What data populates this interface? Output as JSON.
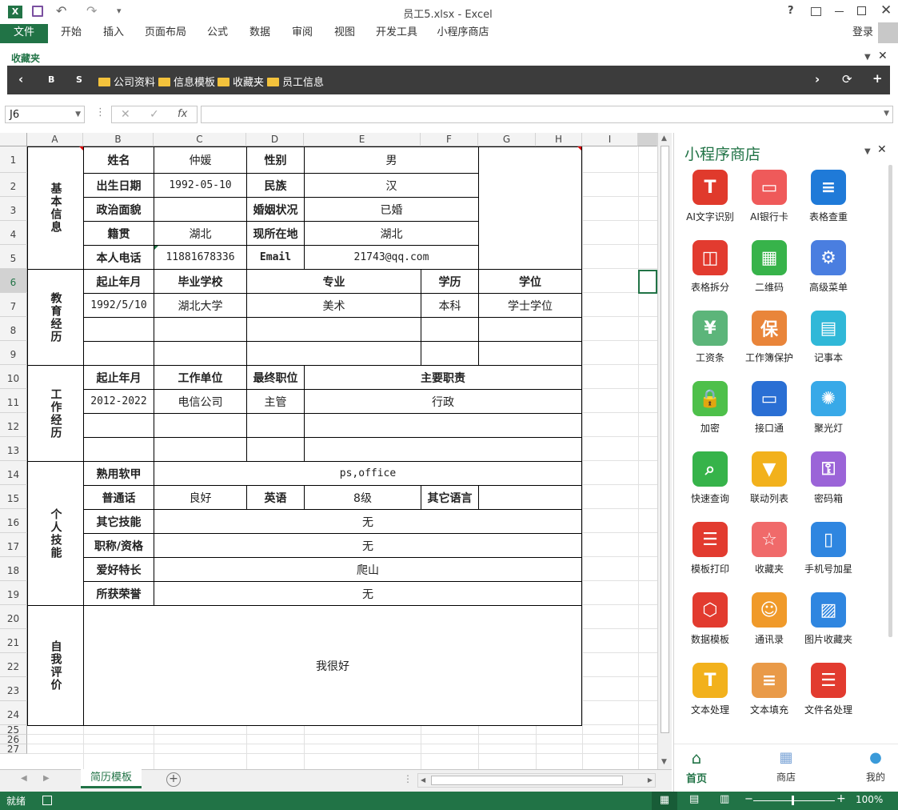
{
  "window": {
    "title": "员工5.xlsx - Excel"
  },
  "qat": {
    "undo": "↶",
    "redo": "↷",
    "more": "▾"
  },
  "ribbon": {
    "file": "文件",
    "tabs": [
      "开始",
      "插入",
      "页面布局",
      "公式",
      "数据",
      "审阅",
      "视图",
      "开发工具",
      "小程序商店"
    ],
    "login": "登录"
  },
  "favbar": {
    "label": "收藏夹",
    "b": "B",
    "s": "S",
    "folders": [
      "公司资料",
      "信息模板",
      "收藏夹",
      "员工信息"
    ]
  },
  "formula": {
    "namebox": "J6",
    "fx": "fx",
    "value": ""
  },
  "sheet": {
    "columns": [
      "A",
      "B",
      "C",
      "D",
      "E",
      "F",
      "G",
      "H",
      "I"
    ],
    "rows": [
      "1",
      "2",
      "3",
      "4",
      "5",
      "6",
      "7",
      "8",
      "9",
      "10",
      "11",
      "12",
      "13",
      "14",
      "15",
      "16",
      "17",
      "18",
      "19",
      "20",
      "21",
      "22",
      "23",
      "24",
      "25",
      "26",
      "27"
    ],
    "sections": {
      "basic": "基本信息",
      "edu": "教育经历",
      "work": "工作经历",
      "skills": "个人技能",
      "self": "自我评价"
    },
    "basic": {
      "name_l": "姓名",
      "name_v": "仲媛",
      "gender_l": "性别",
      "gender_v": "男",
      "dob_l": "出生日期",
      "dob_v": "1992-05-10",
      "nation_l": "民族",
      "nation_v": "汉",
      "politics_l": "政治面貌",
      "politics_v": "",
      "marital_l": "婚姻状况",
      "marital_v": "已婚",
      "native_l": "籍贯",
      "native_v": "湖北",
      "residence_l": "现所在地",
      "residence_v": "湖北",
      "phone_l": "本人电话",
      "phone_v": "11881678336",
      "email_l": "Email",
      "email_v": "21743@qq.com"
    },
    "edu": {
      "period_l": "起止年月",
      "school_l": "毕业学校",
      "major_l": "专业",
      "degree_l": "学历",
      "title_l": "学位",
      "period_v": "1992/5/10",
      "school_v": "湖北大学",
      "major_v": "美术",
      "degree_v": "本科",
      "title_v": "学士学位"
    },
    "work": {
      "period_l": "起止年月",
      "company_l": "工作单位",
      "position_l": "最终职位",
      "duty_l": "主要职责",
      "period_v": "2012-2022",
      "company_v": "电信公司",
      "position_v": "主管",
      "duty_v": "行政"
    },
    "skills": {
      "software_l": "熟用软甲",
      "software_v": "ps,office",
      "mandarin_l": "普通话",
      "mandarin_v": "良好",
      "english_l": "英语",
      "english_v": "8级",
      "otherlang_l": "其它语言",
      "otherlang_v": "",
      "other_l": "其它技能",
      "other_v": "无",
      "cert_l": "职称/资格",
      "cert_v": "无",
      "hobby_l": "爱好特长",
      "hobby_v": "爬山",
      "honor_l": "所获荣誉",
      "honor_v": "无"
    },
    "self_v": "我很好",
    "tab_name": "简历模板"
  },
  "panel": {
    "title": "小程序商店",
    "apps": [
      {
        "name": "AI文字识别",
        "icon": "text-recognition-icon",
        "color": "#e03a2c",
        "glyph": "T"
      },
      {
        "name": "AI银行卡",
        "icon": "bank-card-icon",
        "color": "#ef5a5a",
        "glyph": "▭"
      },
      {
        "name": "表格查重",
        "icon": "table-dedupe-icon",
        "color": "#1f7ad8",
        "glyph": "≡"
      },
      {
        "name": "表格拆分",
        "icon": "table-split-icon",
        "color": "#e23b2f",
        "glyph": "◫"
      },
      {
        "name": "二维码",
        "icon": "qrcode-icon",
        "color": "#37b34a",
        "glyph": "▦"
      },
      {
        "name": "高级菜单",
        "icon": "advanced-menu-icon",
        "color": "#4a7ee0",
        "glyph": "⚙"
      },
      {
        "name": "工资条",
        "icon": "payslip-icon",
        "color": "#5cb57a",
        "glyph": "¥"
      },
      {
        "name": "工作簿保护",
        "icon": "workbook-protect-icon",
        "color": "#e9853a",
        "glyph": "保"
      },
      {
        "name": "记事本",
        "icon": "notepad-icon",
        "color": "#30b8d8",
        "glyph": "▤"
      },
      {
        "name": "加密",
        "icon": "lock-icon",
        "color": "#4ec04a",
        "glyph": "🔒"
      },
      {
        "name": "接口通",
        "icon": "monitor-icon",
        "color": "#2a6fd4",
        "glyph": "▭"
      },
      {
        "name": "聚光灯",
        "icon": "spotlight-icon",
        "color": "#38a9e8",
        "glyph": "✺"
      },
      {
        "name": "快速查询",
        "icon": "quick-search-icon",
        "color": "#36b34a",
        "glyph": "⌕"
      },
      {
        "name": "联动列表",
        "icon": "linked-list-icon",
        "color": "#f2b11c",
        "glyph": "▼"
      },
      {
        "name": "密码箱",
        "icon": "password-box-icon",
        "color": "#9b64d8",
        "glyph": "⚿"
      },
      {
        "name": "模板打印",
        "icon": "template-print-icon",
        "color": "#e23b2f",
        "glyph": "☰"
      },
      {
        "name": "收藏夹",
        "icon": "favorites-icon",
        "color": "#f06a6a",
        "glyph": "☆"
      },
      {
        "name": "手机号加星",
        "icon": "phone-star-icon",
        "color": "#2f86e0",
        "glyph": "▯"
      },
      {
        "name": "数据模板",
        "icon": "data-template-icon",
        "color": "#e23b2f",
        "glyph": "⬡"
      },
      {
        "name": "通讯录",
        "icon": "contacts-icon",
        "color": "#f09a2a",
        "glyph": "☺"
      },
      {
        "name": "图片收藏夹",
        "icon": "picture-favorites-icon",
        "color": "#2f86e0",
        "glyph": "▨"
      },
      {
        "name": "文本处理",
        "icon": "text-process-icon",
        "color": "#f2b11c",
        "glyph": "T"
      },
      {
        "name": "文本填充",
        "icon": "text-fill-icon",
        "color": "#e99a48",
        "glyph": "≡"
      },
      {
        "name": "文件名处理",
        "icon": "filename-process-icon",
        "color": "#e23b2f",
        "glyph": "☰"
      }
    ],
    "nav": {
      "home": "首页",
      "store": "商店",
      "mine": "我的"
    }
  },
  "status": {
    "ready": "就绪",
    "zoom": "100%"
  },
  "colors": {
    "excel_green": "#217346",
    "favbar_bg": "#3c3c3c"
  }
}
